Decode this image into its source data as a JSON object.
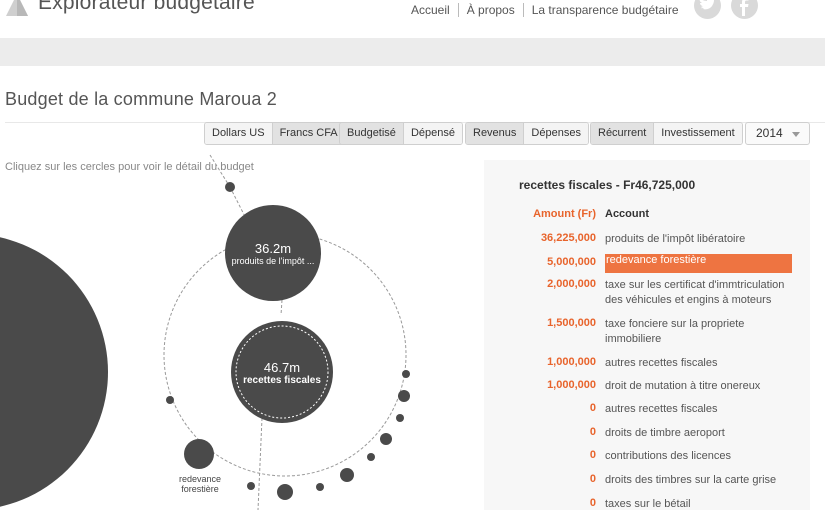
{
  "header": {
    "app_title": "Explorateur budgétaire",
    "nav": [
      "Accueil",
      "À propos",
      "La transparence budgétaire"
    ],
    "social": [
      "twitter-icon",
      "facebook-icon"
    ]
  },
  "page": {
    "title": "Budget de la commune Maroua 2",
    "hint": "Cliquez sur les cercles pour voir le détail du budget"
  },
  "toolbar": {
    "currency": [
      "Dollars US",
      "Francs CFA"
    ],
    "budget_mode": [
      "Budgetisé",
      "Dépensé"
    ],
    "direction": [
      "Revenus",
      "Dépenses"
    ],
    "type": [
      "Récurrent",
      "Investissement"
    ],
    "year": "2014"
  },
  "bubbles": {
    "center": {
      "value": "46.7m",
      "label": "recettes fiscales"
    },
    "top": {
      "value": "36.2m",
      "label": "produits de l'impôt ..."
    },
    "small_label": "redevance forestière"
  },
  "detail": {
    "title": "recettes fiscales - Fr46,725,000",
    "col_amount": "Amount (Fr)",
    "col_account": "Account",
    "rows": [
      {
        "amount": "36,225,000",
        "account": "produits de l'impôt libératoire"
      },
      {
        "amount": "5,000,000",
        "account": "redevance forestière"
      },
      {
        "amount": "2,000,000",
        "account": "taxe sur les certificat d'immtriculation des véhicules et engins à moteurs"
      },
      {
        "amount": "1,500,000",
        "account": "taxe fonciere sur la propriete immobiliere"
      },
      {
        "amount": "1,000,000",
        "account": "autres recettes fiscales"
      },
      {
        "amount": "1,000,000",
        "account": "droit de mutation à titre onereux"
      },
      {
        "amount": "0",
        "account": "autres recettes fiscales"
      },
      {
        "amount": "0",
        "account": "droits de timbre aeroport"
      },
      {
        "amount": "0",
        "account": "contributions des licences"
      },
      {
        "amount": "0",
        "account": "droits des timbres sur la carte grise"
      },
      {
        "amount": "0",
        "account": "taxes sur le bétail"
      }
    ]
  },
  "colors": {
    "accent": "#e8642c",
    "highlight": "#ee7441",
    "bubble": "#4a4a4a"
  }
}
